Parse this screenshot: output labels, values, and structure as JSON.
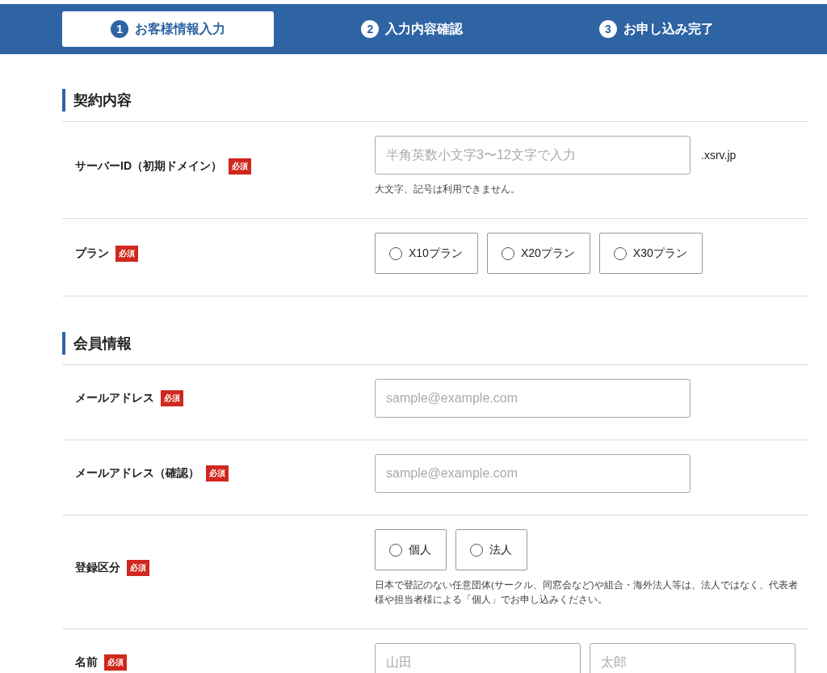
{
  "steps": [
    {
      "number": "1",
      "label": "お客様情報入力",
      "selected": true
    },
    {
      "number": "2",
      "label": "入力内容確認",
      "selected": false
    },
    {
      "number": "3",
      "label": "お申し込み完了",
      "selected": false
    }
  ],
  "sections": [
    {
      "title": "契約内容",
      "rows": [
        {
          "kind": "text",
          "label": "サーバーID（初期ドメイン）",
          "required_badge": "必須",
          "placeholder": "半角英数小文字3〜12文字で入力",
          "suffix": ".xsrv.jp",
          "note": "大文字、記号は利用できません。"
        },
        {
          "kind": "radio",
          "label": "プラン",
          "required_badge": "必須",
          "options": [
            {
              "label": "X10プラン",
              "selected": false
            },
            {
              "label": "X20プラン",
              "selected": false
            },
            {
              "label": "X30プラン",
              "selected": false
            }
          ]
        }
      ]
    },
    {
      "title": "会員情報",
      "rows": [
        {
          "kind": "text",
          "label": "メールアドレス",
          "required_badge": "必須",
          "placeholder": "sample@example.com"
        },
        {
          "kind": "text",
          "label": "メールアドレス（確認）",
          "required_badge": "必須",
          "placeholder": "sample@example.com"
        },
        {
          "kind": "radio",
          "label": "登録区分",
          "required_badge": "必須",
          "options": [
            {
              "label": "個人",
              "selected": false
            },
            {
              "label": "法人",
              "selected": false
            }
          ],
          "note": "日本で登記のない任意団体(サークル、同窓会など)や組合・海外法人等は、法人ではなく、代表者様や担当者様による「個人」でお申し込みください。"
        },
        {
          "kind": "name",
          "label": "名前",
          "required_badge": "必須",
          "fields": [
            {
              "placeholder": "山田"
            },
            {
              "placeholder": "太郎"
            }
          ]
        }
      ]
    }
  ]
}
